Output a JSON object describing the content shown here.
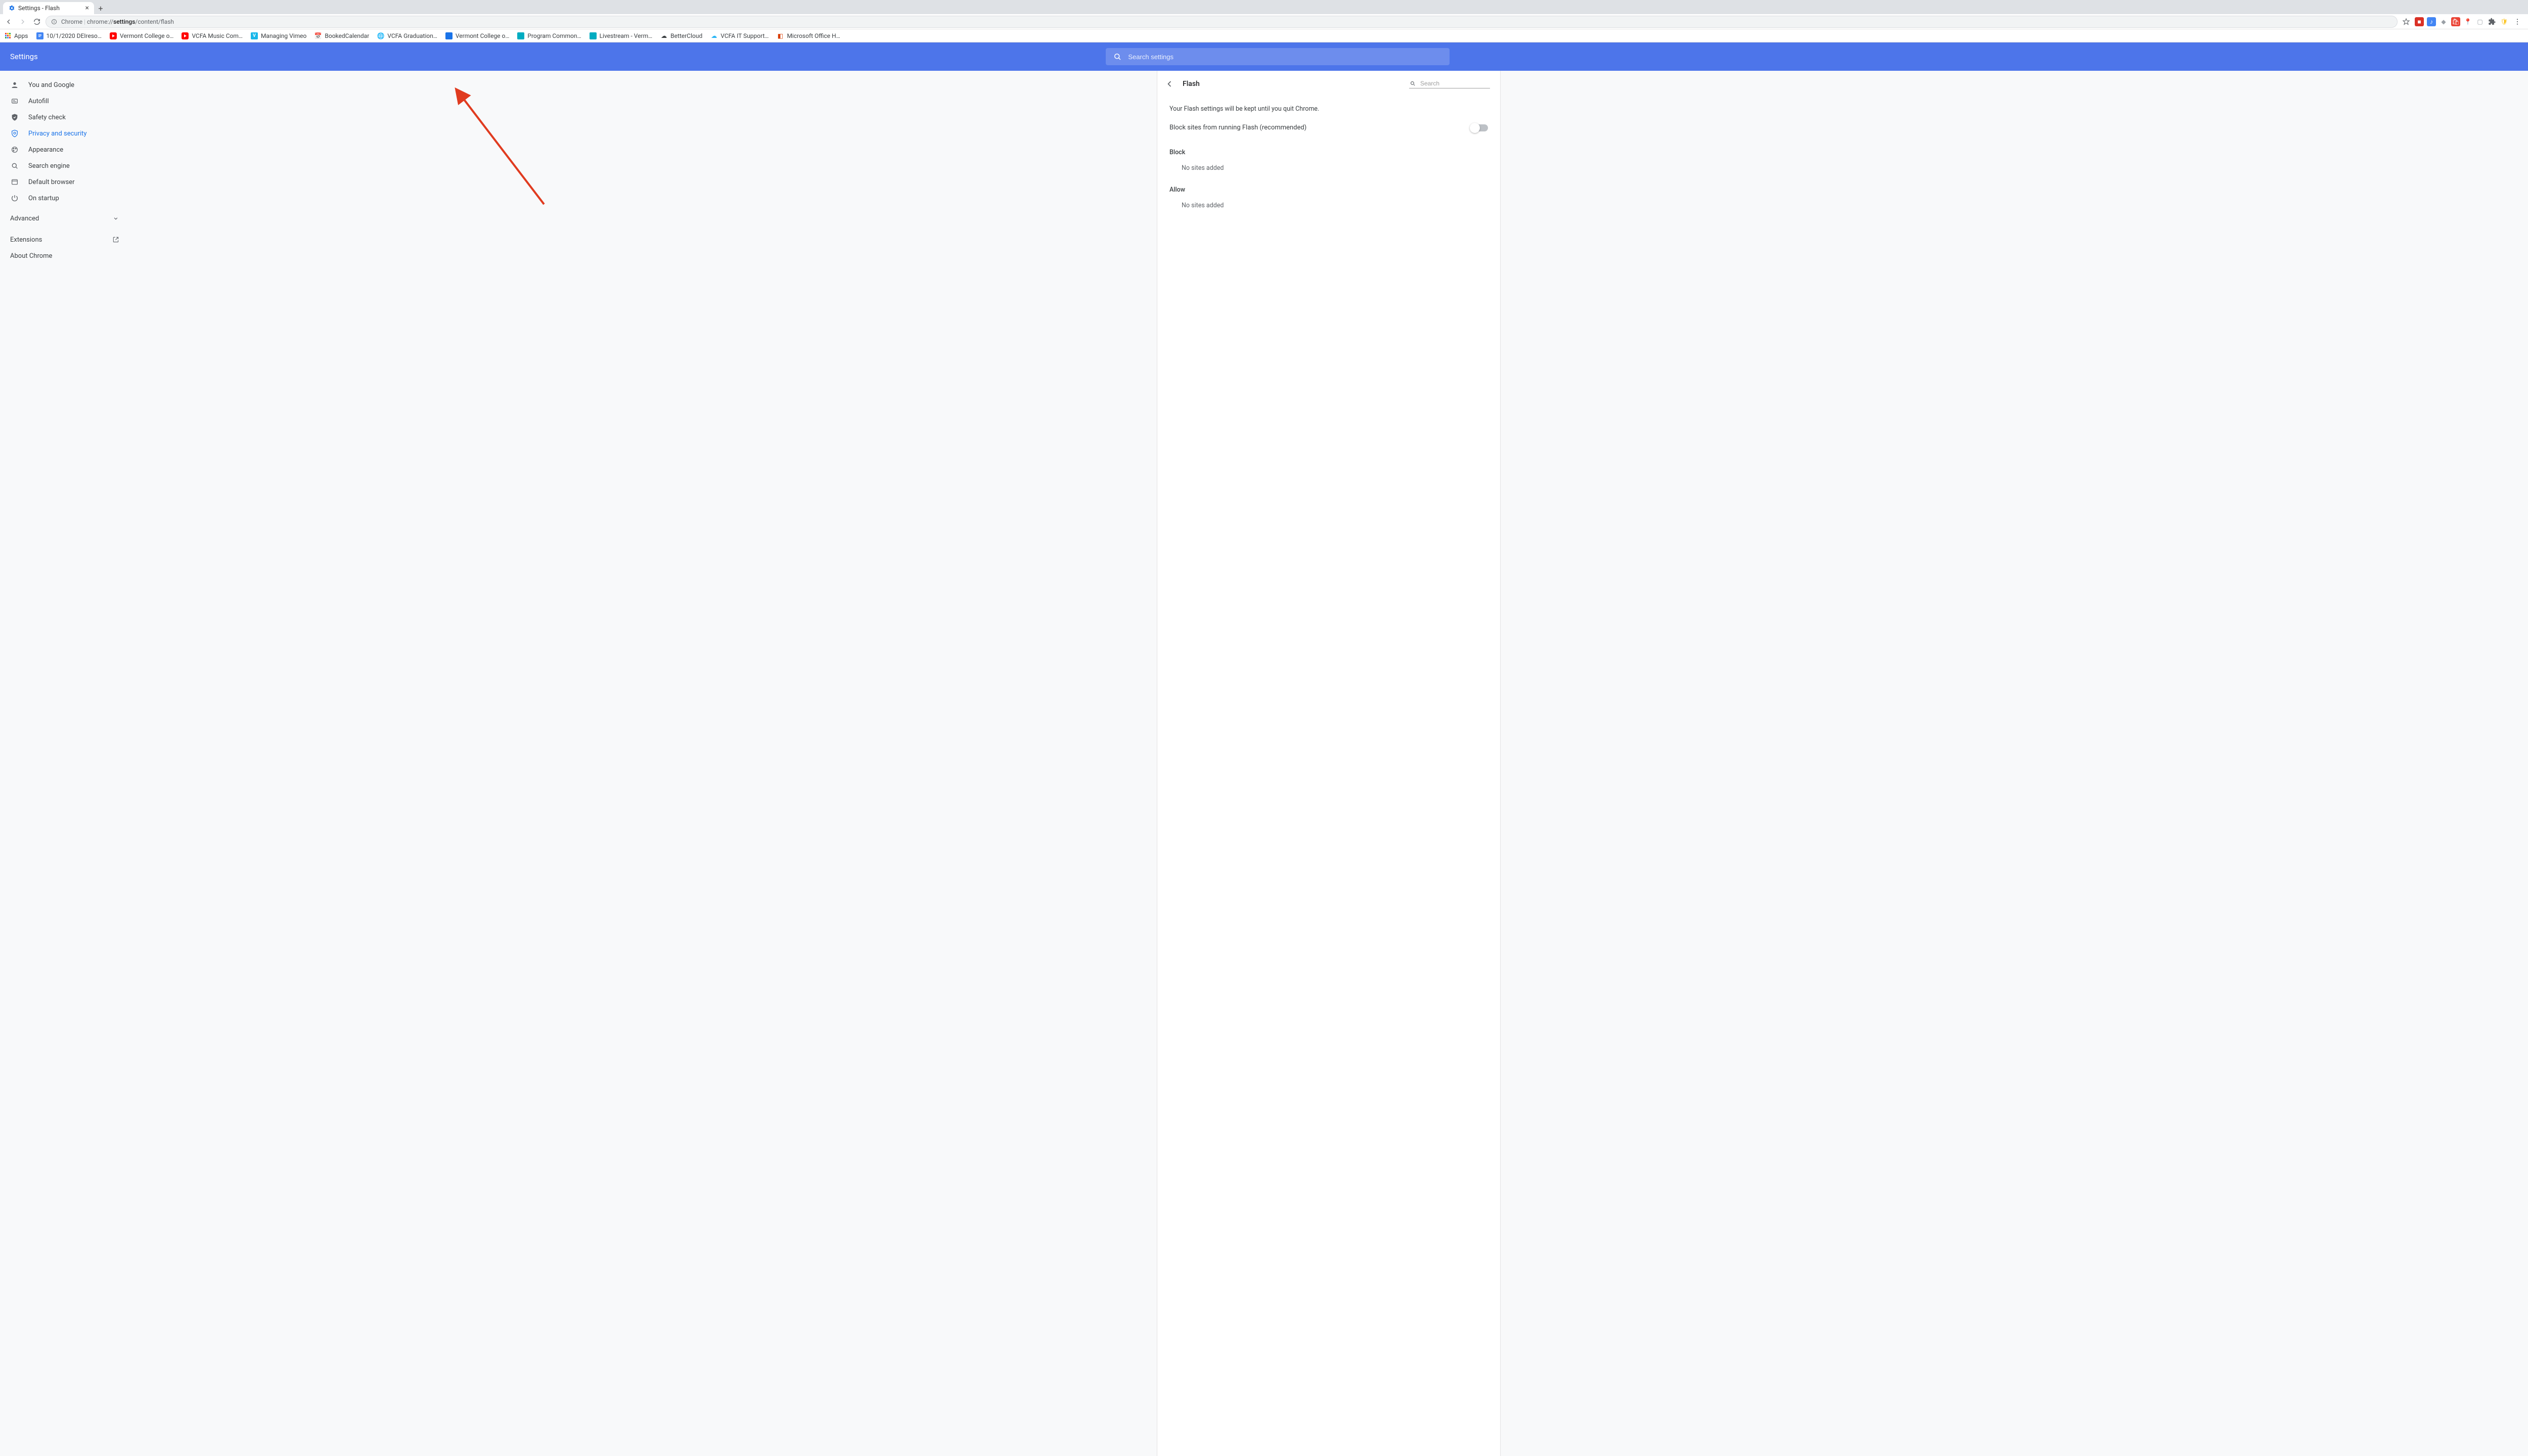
{
  "window": {
    "tab_title": "Settings - Flash"
  },
  "toolbar": {
    "url_scheme": "Chrome",
    "url_pre": "chrome://",
    "url_bold": "settings",
    "url_rest": "/content/flash"
  },
  "bookmarks": [
    {
      "label": "Apps",
      "type": "apps"
    },
    {
      "label": "10/1/2020 DEIreso…",
      "type": "doc"
    },
    {
      "label": "Vermont College o…",
      "type": "yt"
    },
    {
      "label": "VCFA Music Com…",
      "type": "yt"
    },
    {
      "label": "Managing Vimeo",
      "type": "vimeo"
    },
    {
      "label": "BookedCalendar",
      "type": "cal"
    },
    {
      "label": "VCFA Graduation…",
      "type": "globe"
    },
    {
      "label": "Vermont College o…",
      "type": "sq-blue"
    },
    {
      "label": "Program Common…",
      "type": "sq-teal"
    },
    {
      "label": "Livestream - Verm…",
      "type": "sq-teal"
    },
    {
      "label": "BetterCloud",
      "type": "cloud"
    },
    {
      "label": "VCFA IT Support…",
      "type": "cloud2"
    },
    {
      "label": "Microsoft Office H…",
      "type": "office"
    }
  ],
  "settings_header": {
    "title": "Settings",
    "search_placeholder": "Search settings"
  },
  "sidebar": {
    "items": [
      {
        "label": "You and Google",
        "icon": "person"
      },
      {
        "label": "Autofill",
        "icon": "autofill"
      },
      {
        "label": "Safety check",
        "icon": "shield"
      },
      {
        "label": "Privacy and security",
        "icon": "security",
        "selected": true
      },
      {
        "label": "Appearance",
        "icon": "paint"
      },
      {
        "label": "Search engine",
        "icon": "search"
      },
      {
        "label": "Default browser",
        "icon": "browser"
      },
      {
        "label": "On startup",
        "icon": "power"
      }
    ],
    "advanced_label": "Advanced",
    "extensions_label": "Extensions",
    "about_label": "About Chrome"
  },
  "content": {
    "page_title": "Flash",
    "search_placeholder": "Search",
    "info": "Your Flash settings will be kept until you quit Chrome.",
    "toggle_label": "Block sites from running Flash (recommended)",
    "toggle_on": false,
    "sections": {
      "block": {
        "label": "Block",
        "empty": "No sites added"
      },
      "allow": {
        "label": "Allow",
        "empty": "No sites added"
      }
    }
  },
  "annotation": {
    "arrow_color": "#e03b1f"
  }
}
